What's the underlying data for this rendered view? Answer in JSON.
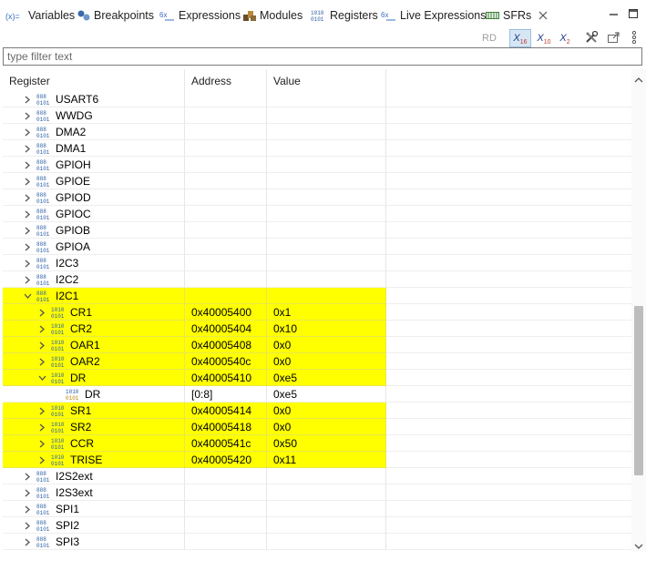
{
  "tabs": [
    {
      "label": "Variables",
      "icon": "variables-icon",
      "active": false
    },
    {
      "label": "Breakpoints",
      "icon": "breakpoints-icon",
      "active": false
    },
    {
      "label": "Expressions",
      "icon": "expressions-icon",
      "active": false
    },
    {
      "label": "Modules",
      "icon": "modules-icon",
      "active": false
    },
    {
      "label": "Registers",
      "icon": "registers-icon",
      "active": false
    },
    {
      "label": "Live Expressions",
      "icon": "live-expressions-icon",
      "active": false
    },
    {
      "label": "SFRs",
      "icon": "sfrs-icon",
      "active": true
    }
  ],
  "toolbar": {
    "rd_label": "RD",
    "hex_label": "X",
    "hex_sub": "16",
    "dec_label": "X",
    "dec_sub": "10",
    "bin_label": "X",
    "bin_sub": "2"
  },
  "filter": {
    "placeholder": "type filter text",
    "value": ""
  },
  "columns": [
    "Register",
    "Address",
    "Value"
  ],
  "colors": {
    "highlight": "#ffff00",
    "selected_tool": "#d6e6f5"
  },
  "rows": [
    {
      "name": "USART6",
      "address": "",
      "value": "",
      "level": 0,
      "expanded": false,
      "kind": "peripheral",
      "highlight": false
    },
    {
      "name": "WWDG",
      "address": "",
      "value": "",
      "level": 0,
      "expanded": false,
      "kind": "peripheral",
      "highlight": false
    },
    {
      "name": "DMA2",
      "address": "",
      "value": "",
      "level": 0,
      "expanded": false,
      "kind": "peripheral",
      "highlight": false
    },
    {
      "name": "DMA1",
      "address": "",
      "value": "",
      "level": 0,
      "expanded": false,
      "kind": "peripheral",
      "highlight": false
    },
    {
      "name": "GPIOH",
      "address": "",
      "value": "",
      "level": 0,
      "expanded": false,
      "kind": "peripheral",
      "highlight": false
    },
    {
      "name": "GPIOE",
      "address": "",
      "value": "",
      "level": 0,
      "expanded": false,
      "kind": "peripheral",
      "highlight": false
    },
    {
      "name": "GPIOD",
      "address": "",
      "value": "",
      "level": 0,
      "expanded": false,
      "kind": "peripheral",
      "highlight": false
    },
    {
      "name": "GPIOC",
      "address": "",
      "value": "",
      "level": 0,
      "expanded": false,
      "kind": "peripheral",
      "highlight": false
    },
    {
      "name": "GPIOB",
      "address": "",
      "value": "",
      "level": 0,
      "expanded": false,
      "kind": "peripheral",
      "highlight": false
    },
    {
      "name": "GPIOA",
      "address": "",
      "value": "",
      "level": 0,
      "expanded": false,
      "kind": "peripheral",
      "highlight": false
    },
    {
      "name": "I2C3",
      "address": "",
      "value": "",
      "level": 0,
      "expanded": false,
      "kind": "peripheral",
      "highlight": false
    },
    {
      "name": "I2C2",
      "address": "",
      "value": "",
      "level": 0,
      "expanded": false,
      "kind": "peripheral",
      "highlight": false
    },
    {
      "name": "I2C1",
      "address": "",
      "value": "",
      "level": 0,
      "expanded": true,
      "kind": "peripheral",
      "highlight": true
    },
    {
      "name": "CR1",
      "address": "0x40005400",
      "value": "0x1",
      "level": 1,
      "expanded": false,
      "kind": "register",
      "highlight": true
    },
    {
      "name": "CR2",
      "address": "0x40005404",
      "value": "0x10",
      "level": 1,
      "expanded": false,
      "kind": "register",
      "highlight": true
    },
    {
      "name": "OAR1",
      "address": "0x40005408",
      "value": "0x0",
      "level": 1,
      "expanded": false,
      "kind": "register",
      "highlight": true
    },
    {
      "name": "OAR2",
      "address": "0x4000540c",
      "value": "0x0",
      "level": 1,
      "expanded": false,
      "kind": "register",
      "highlight": true
    },
    {
      "name": "DR",
      "address": "0x40005410",
      "value": "0xe5",
      "level": 1,
      "expanded": true,
      "kind": "register",
      "highlight": true
    },
    {
      "name": "DR",
      "address": "[0:8]",
      "value": "0xe5",
      "level": 2,
      "expanded": false,
      "kind": "field",
      "highlight": false
    },
    {
      "name": "SR1",
      "address": "0x40005414",
      "value": "0x0",
      "level": 1,
      "expanded": false,
      "kind": "register",
      "highlight": true
    },
    {
      "name": "SR2",
      "address": "0x40005418",
      "value": "0x0",
      "level": 1,
      "expanded": false,
      "kind": "register",
      "highlight": true
    },
    {
      "name": "CCR",
      "address": "0x4000541c",
      "value": "0x50",
      "level": 1,
      "expanded": false,
      "kind": "register",
      "highlight": true
    },
    {
      "name": "TRISE",
      "address": "0x40005420",
      "value": "0x11",
      "level": 1,
      "expanded": false,
      "kind": "register",
      "highlight": true
    },
    {
      "name": "I2S2ext",
      "address": "",
      "value": "",
      "level": 0,
      "expanded": false,
      "kind": "peripheral",
      "highlight": false
    },
    {
      "name": "I2S3ext",
      "address": "",
      "value": "",
      "level": 0,
      "expanded": false,
      "kind": "peripheral",
      "highlight": false
    },
    {
      "name": "SPI1",
      "address": "",
      "value": "",
      "level": 0,
      "expanded": false,
      "kind": "peripheral",
      "highlight": false
    },
    {
      "name": "SPI2",
      "address": "",
      "value": "",
      "level": 0,
      "expanded": false,
      "kind": "peripheral",
      "highlight": false
    },
    {
      "name": "SPI3",
      "address": "",
      "value": "",
      "level": 0,
      "expanded": false,
      "kind": "peripheral",
      "highlight": false
    }
  ]
}
